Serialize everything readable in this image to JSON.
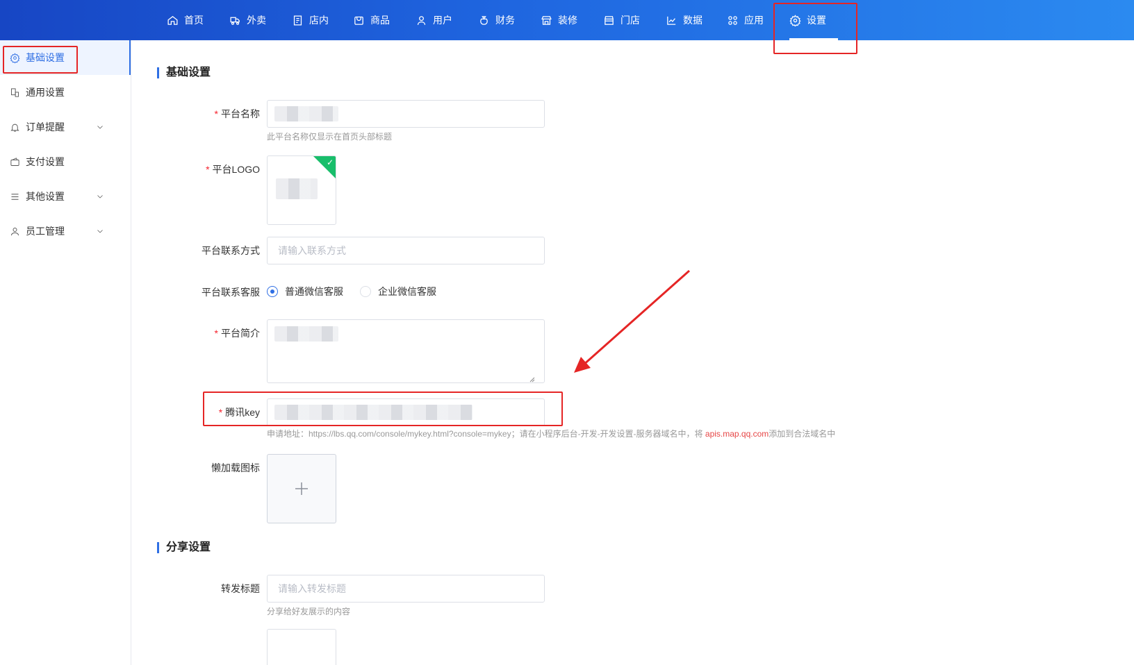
{
  "nav": {
    "items": [
      {
        "label": "首页",
        "icon": "home-icon"
      },
      {
        "label": "外卖",
        "icon": "delivery-icon"
      },
      {
        "label": "店内",
        "icon": "store-inside-icon"
      },
      {
        "label": "商品",
        "icon": "bag-icon"
      },
      {
        "label": "用户",
        "icon": "user-icon"
      },
      {
        "label": "财务",
        "icon": "money-bag-icon"
      },
      {
        "label": "装修",
        "icon": "shop-decor-icon"
      },
      {
        "label": "门店",
        "icon": "store-icon"
      },
      {
        "label": "数据",
        "icon": "chart-icon"
      },
      {
        "label": "应用",
        "icon": "apps-icon"
      },
      {
        "label": "设置",
        "icon": "gear-icon"
      }
    ],
    "active": "设置"
  },
  "sidebar": {
    "items": [
      {
        "label": "基础设置",
        "icon": "gear-icon",
        "active": true
      },
      {
        "label": "通用设置",
        "icon": "devices-icon"
      },
      {
        "label": "订单提醒",
        "icon": "bell-icon",
        "expandable": true
      },
      {
        "label": "支付设置",
        "icon": "wallet-icon"
      },
      {
        "label": "其他设置",
        "icon": "menu-lines-icon",
        "expandable": true
      },
      {
        "label": "员工管理",
        "icon": "person-icon",
        "expandable": true
      }
    ]
  },
  "form": {
    "section_basic": "基础设置",
    "platform_name": {
      "label": "平台名称",
      "hint": "此平台名称仅显示在首页头部标题"
    },
    "platform_logo": {
      "label": "平台LOGO"
    },
    "contact": {
      "label": "平台联系方式",
      "placeholder": "请输入联系方式"
    },
    "service": {
      "label": "平台联系客服",
      "options": [
        "普通微信客服",
        "企业微信客服"
      ],
      "selected": "普通微信客服"
    },
    "intro": {
      "label": "平台简介"
    },
    "tencent_key": {
      "label": "腾讯key",
      "hint_prefix": "申请地址：https://lbs.qq.com/console/mykey.html?console=mykey；请在小程序后台-开发-开发设置-服务器域名中，将 ",
      "hint_domain": "apis.map.qq.com",
      "hint_suffix": "添加到合法域名中"
    },
    "lazy_icon": {
      "label": "懒加载图标"
    },
    "section_share": "分享设置",
    "share_title": {
      "label": "转发标题",
      "placeholder": "请输入转发标题",
      "hint": "分享给好友展示的内容"
    }
  },
  "colors": {
    "brand": "#2f6fe4",
    "annotation": "#e52525",
    "success": "#19be6b"
  }
}
